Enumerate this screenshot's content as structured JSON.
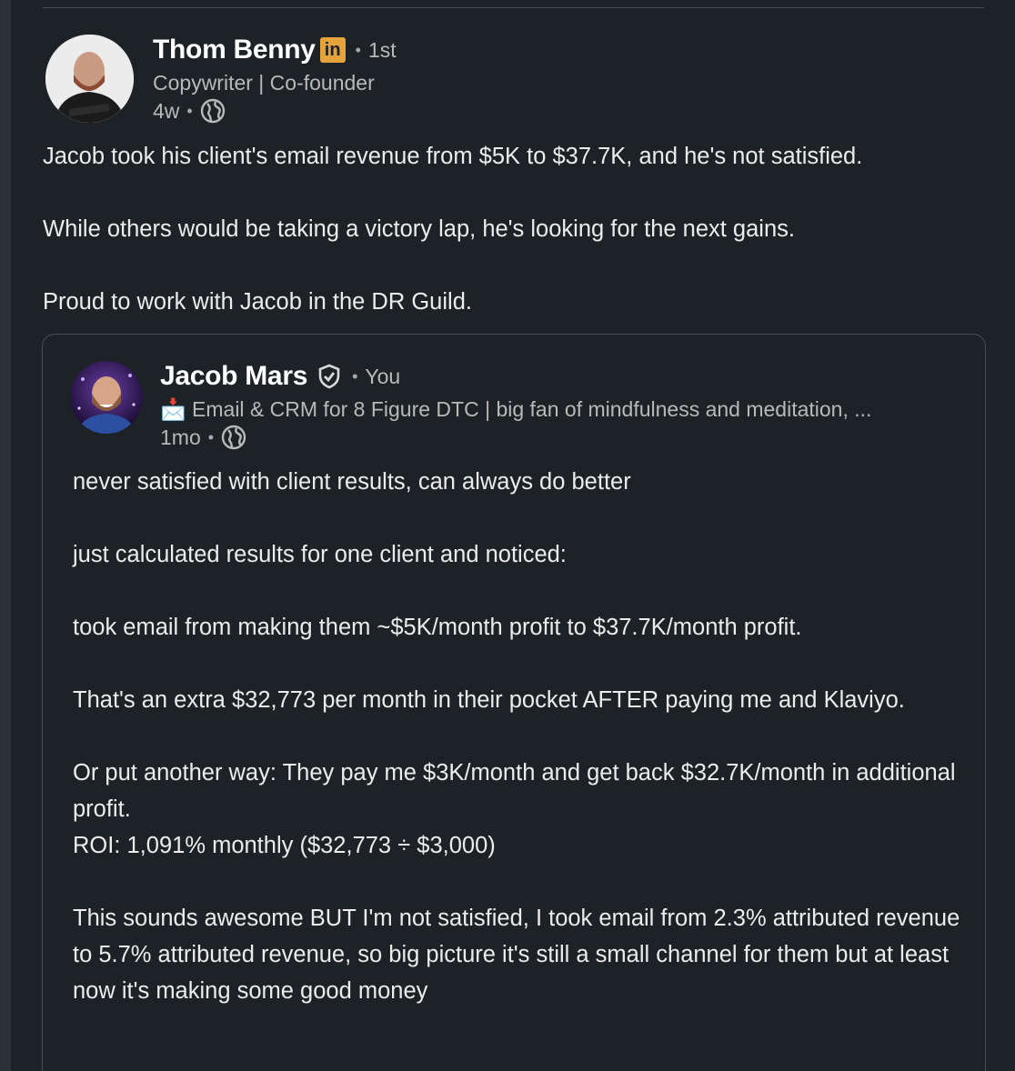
{
  "post": {
    "author_name": "Thom Benny",
    "badge": "in",
    "connection": "1st",
    "headline": "Copywriter | Co-founder",
    "time": "4w",
    "visibility_icon": "globe-icon",
    "paragraphs": [
      "Jacob took his client's email revenue from $5K to $37.7K, and he's not satisfied.",
      "While others would be taking a victory lap, he's looking for the next gains.",
      "Proud to work with Jacob in the DR Guild."
    ]
  },
  "quoted": {
    "author_name": "Jacob Mars",
    "verified_icon": "verified-shield-icon",
    "connection": "You",
    "headline_emoji": "📩",
    "headline": "Email & CRM for 8 Figure DTC | big fan of mindfulness and meditation, ...",
    "time": "1mo",
    "visibility_icon": "globe-icon",
    "lines": [
      "never satisfied with client results, can always do better",
      "just calculated results for one client and noticed:",
      "took email from making them ~$5K/month profit to $37.7K/month profit.",
      "That's an extra $32,773 per month in their pocket AFTER paying me and Klaviyo.",
      "Or put another way: They pay me $3K/month and get back $32.7K/month in additional profit.",
      "ROI: 1,091% monthly ($32,773 ÷ $3,000)",
      "This sounds awesome BUT I'm not satisfied, I took email from 2.3% attributed revenue to 5.7% attributed revenue, so big picture it's still a small channel for them but at least now it's making some good money"
    ]
  },
  "colors": {
    "background": "#1d2226",
    "premium_badge": "#e5a33c",
    "text_primary": "#ececec",
    "text_secondary": "#b9b9b9"
  }
}
